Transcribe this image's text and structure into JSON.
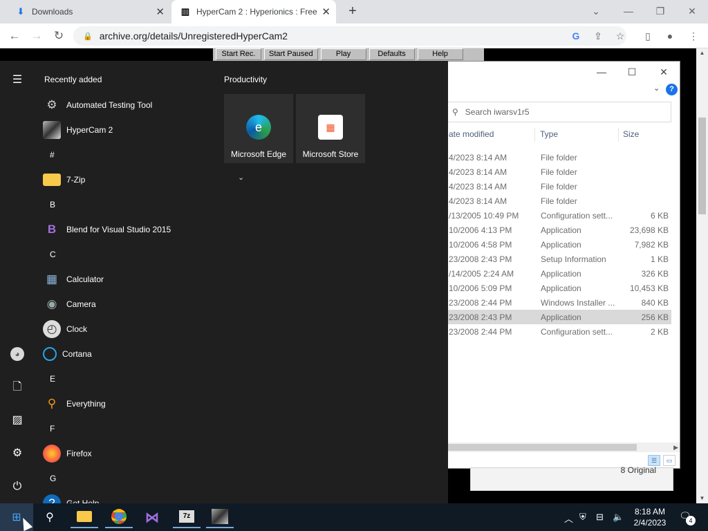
{
  "browser": {
    "tabs": [
      {
        "label": "Downloads",
        "icon": "download-icon"
      },
      {
        "label": "HyperCam 2 : Hyperionics : Free",
        "icon": "archive-icon"
      }
    ],
    "url": "archive.org/details/UnregisteredHyperCam2"
  },
  "hypercam": {
    "buttons": [
      "Start Rec.",
      "Start Paused",
      "Play",
      "Defaults",
      "Help"
    ]
  },
  "explorer": {
    "search_placeholder": "Search iwarsv1r5",
    "columns": [
      "ate modified",
      "Type",
      "Size"
    ],
    "rows": [
      {
        "date": "4/2023 8:14 AM",
        "type": "File folder",
        "size": ""
      },
      {
        "date": "4/2023 8:14 AM",
        "type": "File folder",
        "size": ""
      },
      {
        "date": "4/2023 8:14 AM",
        "type": "File folder",
        "size": ""
      },
      {
        "date": "4/2023 8:14 AM",
        "type": "File folder",
        "size": ""
      },
      {
        "date": "/13/2005 10:49 PM",
        "type": "Configuration sett...",
        "size": "6 KB"
      },
      {
        "date": "10/2006 4:13 PM",
        "type": "Application",
        "size": "23,698 KB"
      },
      {
        "date": "10/2006 4:58 PM",
        "type": "Application",
        "size": "7,982 KB"
      },
      {
        "date": "23/2008 2:43 PM",
        "type": "Setup Information",
        "size": "1 KB"
      },
      {
        "date": "/14/2005 2:24 AM",
        "type": "Application",
        "size": "326 KB"
      },
      {
        "date": "10/2006 5:09 PM",
        "type": "Application",
        "size": "10,453 KB"
      },
      {
        "date": "23/2008 2:44 PM",
        "type": "Windows Installer ...",
        "size": "840 KB"
      },
      {
        "date": "23/2008 2:43 PM",
        "type": "Application",
        "size": "256 KB",
        "selected": true
      },
      {
        "date": "23/2008 2:44 PM",
        "type": "Configuration sett...",
        "size": "2 KB"
      }
    ],
    "original_label": "8 Original"
  },
  "start_menu": {
    "recent_title": "Recently added",
    "productivity_title": "Productivity",
    "tiles": [
      {
        "label": "Microsoft Edge",
        "icon": "edge-icon"
      },
      {
        "label": "Microsoft Store",
        "icon": "store-icon"
      }
    ],
    "apps": [
      {
        "label": "Automated Testing Tool",
        "icon": "gear-icon"
      },
      {
        "label": "HyperCam 2",
        "icon": "hypercam-icon"
      },
      {
        "letter": "#"
      },
      {
        "label": "7-Zip",
        "icon": "folder-icon",
        "expandable": true
      },
      {
        "letter": "B"
      },
      {
        "label": "Blend for Visual Studio 2015",
        "icon": "blend-icon"
      },
      {
        "letter": "C"
      },
      {
        "label": "Calculator",
        "icon": "calculator-icon"
      },
      {
        "label": "Camera",
        "icon": "camera-icon"
      },
      {
        "label": "Clock",
        "icon": "clock-icon"
      },
      {
        "label": "Cortana",
        "icon": "cortana-icon"
      },
      {
        "letter": "E"
      },
      {
        "label": "Everything",
        "icon": "search-icon"
      },
      {
        "letter": "F"
      },
      {
        "label": "Firefox",
        "icon": "firefox-icon"
      },
      {
        "letter": "G"
      },
      {
        "label": "Get Help",
        "icon": "help-icon"
      }
    ]
  },
  "taskbar": {
    "time": "8:18 AM",
    "date": "2/4/2023",
    "notifications": "4"
  }
}
